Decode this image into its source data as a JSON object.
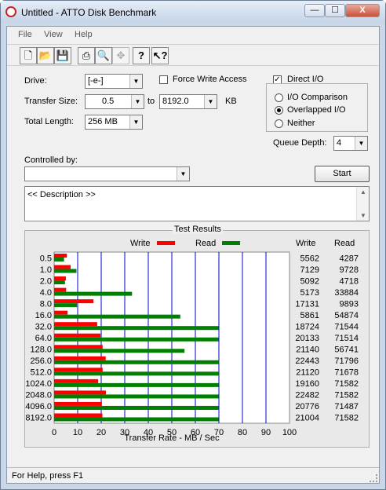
{
  "window": {
    "title": "Untitled - ATTO Disk Benchmark",
    "minimize": "—",
    "maximize": "☐",
    "close": "X"
  },
  "menu": {
    "items": [
      "File",
      "View",
      "Help"
    ]
  },
  "toolbar": {
    "icons": [
      "new-file-icon",
      "open-folder-icon",
      "save-icon",
      "print-icon",
      "print-preview-icon",
      "move-icon",
      "help-icon",
      "context-help-icon"
    ]
  },
  "settings": {
    "drive_label": "Drive:",
    "drive_value": "[-e-]",
    "force_write_label": "Force Write Access",
    "direct_io_label": "Direct I/O",
    "direct_io_checked": true,
    "transfer_size_label": "Transfer Size:",
    "transfer_from": "0.5",
    "transfer_to_label": "to",
    "transfer_to": "8192.0",
    "transfer_unit": "KB",
    "total_length_label": "Total Length:",
    "total_length_value": "256 MB",
    "io_comparison_label": "I/O Comparison",
    "overlapped_io_label": "Overlapped I/O",
    "neither_label": "Neither",
    "queue_depth_label": "Queue Depth:",
    "queue_depth_value": "4",
    "controlled_by_label": "Controlled by:",
    "controlled_by_value": "",
    "start_label": "Start",
    "description_text": "<< Description >>"
  },
  "results": {
    "title": "Test Results",
    "write_col": "Write",
    "read_col": "Read"
  },
  "chart_data": {
    "type": "bar",
    "title": "Test Results",
    "xlabel": "Transfer Rate - MB / Sec",
    "ylabel": "",
    "xlim": [
      0,
      100
    ],
    "xticks": [
      "0",
      "10",
      "20",
      "30",
      "40",
      "50",
      "60",
      "70",
      "80",
      "90",
      "100"
    ],
    "legend": "top",
    "categories": [
      "0.5",
      "1.0",
      "2.0",
      "4.0",
      "8.0",
      "16.0",
      "32.0",
      "64.0",
      "128.0",
      "256.0",
      "512.0",
      "1024.0",
      "2048.0",
      "4096.0",
      "8192.0"
    ],
    "series": [
      {
        "name": "Write",
        "color": "#ff0000",
        "values": [
          5.4,
          7.0,
          5.0,
          5.1,
          16.7,
          5.7,
          18.3,
          19.7,
          20.6,
          21.9,
          20.6,
          18.7,
          22.0,
          20.3,
          20.5
        ]
      },
      {
        "name": "Read",
        "color": "#008000",
        "values": [
          4.2,
          9.5,
          4.6,
          33.1,
          9.7,
          53.6,
          69.9,
          69.8,
          55.4,
          70.1,
          70.0,
          69.9,
          69.9,
          69.8,
          69.9
        ]
      }
    ],
    "write_text": [
      "5562",
      "7129",
      "5092",
      "5173",
      "17131",
      "5861",
      "18724",
      "20133",
      "21140",
      "22443",
      "21120",
      "19160",
      "22482",
      "20776",
      "21004"
    ],
    "read_text": [
      "4287",
      "9728",
      "4718",
      "33884",
      "9893",
      "54874",
      "71544",
      "71514",
      "56741",
      "71796",
      "71678",
      "71582",
      "71582",
      "71487",
      "71582"
    ]
  },
  "status": {
    "text": "For Help, press F1"
  }
}
